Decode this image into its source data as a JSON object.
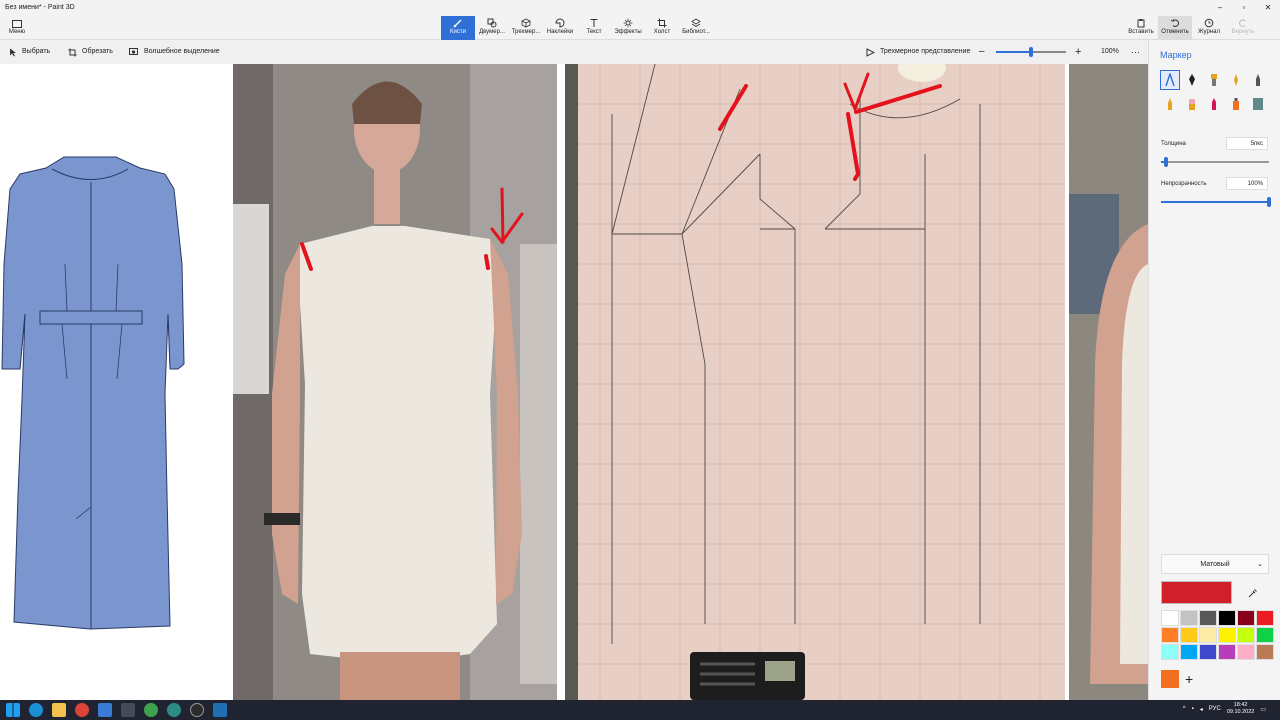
{
  "window": {
    "title": "Без имени* - Paint 3D"
  },
  "menu": {
    "label": "Меню"
  },
  "tools": [
    {
      "label": "Кисти",
      "active": true,
      "icon": "brush-icon"
    },
    {
      "label": "Двумер...",
      "icon": "shapes-2d-icon"
    },
    {
      "label": "Трехмер...",
      "icon": "cube-icon"
    },
    {
      "label": "Наклейки",
      "icon": "sticker-icon"
    },
    {
      "label": "Текст",
      "icon": "text-icon"
    },
    {
      "label": "Эффекты",
      "icon": "sun-icon"
    },
    {
      "label": "Холст",
      "icon": "canvas-icon"
    },
    {
      "label": "Библиот...",
      "icon": "library-icon"
    }
  ],
  "right_tools": [
    {
      "label": "Вставить",
      "icon": "paste-icon"
    },
    {
      "label": "Отменить",
      "icon": "undo-icon"
    },
    {
      "label": "Журнал",
      "icon": "history-icon"
    },
    {
      "label": "Вернуть",
      "icon": "redo-icon",
      "disabled": true
    }
  ],
  "subbar": {
    "select": "Выбрать",
    "crop": "Обрезать",
    "magic_select": "Волшебное выделение",
    "view_3d": "Трехмерное представление",
    "zoom_percent": "100%",
    "zoom_level": 0.5,
    "more": "···"
  },
  "panel": {
    "title": "Маркер",
    "brushes": [
      {
        "icon": "marker-icon",
        "selected": true
      },
      {
        "icon": "calligraphy-pen-icon"
      },
      {
        "icon": "oil-brush-icon"
      },
      {
        "icon": "watercolor-icon"
      },
      {
        "icon": "pixel-pen-icon"
      },
      {
        "icon": "pencil-icon"
      },
      {
        "icon": "eraser-icon"
      },
      {
        "icon": "crayon-icon"
      },
      {
        "icon": "spray-can-icon"
      },
      {
        "icon": "fill-icon"
      }
    ],
    "thickness_label": "Толщина",
    "thickness_value": "5пкс",
    "thickness_level": 0.05,
    "opacity_label": "Непрозрачность",
    "opacity_value": "100%",
    "opacity_level": 1.0,
    "finish": "Матовый",
    "current_color": "#d11f2c",
    "palette": [
      "#ffffff",
      "#c3c3c3",
      "#585858",
      "#000000",
      "#88001b",
      "#ec1c24",
      "#ff7f27",
      "#ffca18",
      "#fdeca6",
      "#fff200",
      "#c4ff0e",
      "#0ed145",
      "#8cfffb",
      "#00a8f3",
      "#3f48cc",
      "#b83dba",
      "#ffaec8",
      "#b97a56"
    ],
    "custom_color": "#f37021",
    "add_label": "+"
  },
  "taskbar": {
    "lang": "РУС",
    "time": "18:42",
    "date": "09.10.2022"
  }
}
